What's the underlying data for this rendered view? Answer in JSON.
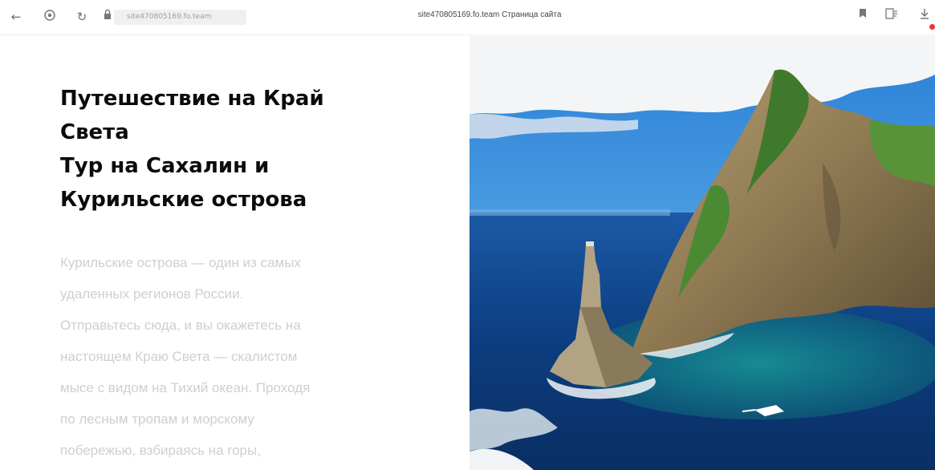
{
  "browser": {
    "address": "site470805169.fo.team",
    "tab_title": "site470805169.fo.team Страница сайта",
    "icons": [
      "back-arrow-icon",
      "shield-icon",
      "reload-icon",
      "lock-icon",
      "bookmark-icon",
      "reader-mode-icon",
      "download-icon"
    ]
  },
  "colors": {
    "title_text": "#0b0b0b",
    "body_text": "#cfcfcf",
    "download_badge": "#e53935",
    "sky": "#1f6fc4",
    "sea": "#0b3a78"
  },
  "hero": {
    "title_lines": [
      "Путешествие на Край",
      "Света",
      "Тур на Сахалин и",
      "Курильские острова"
    ],
    "description_lines": [
      "Курильские острова — один из самых",
      "удаленных регионов России.",
      "Отправьтесь сюда, и вы окажетесь на",
      "настоящем Краю Света — скалистом",
      "мысе с видом на Тихий океан. Проходя",
      "по лесным тропам и морскому",
      "побережью, взбираясь на горы,"
    ]
  }
}
